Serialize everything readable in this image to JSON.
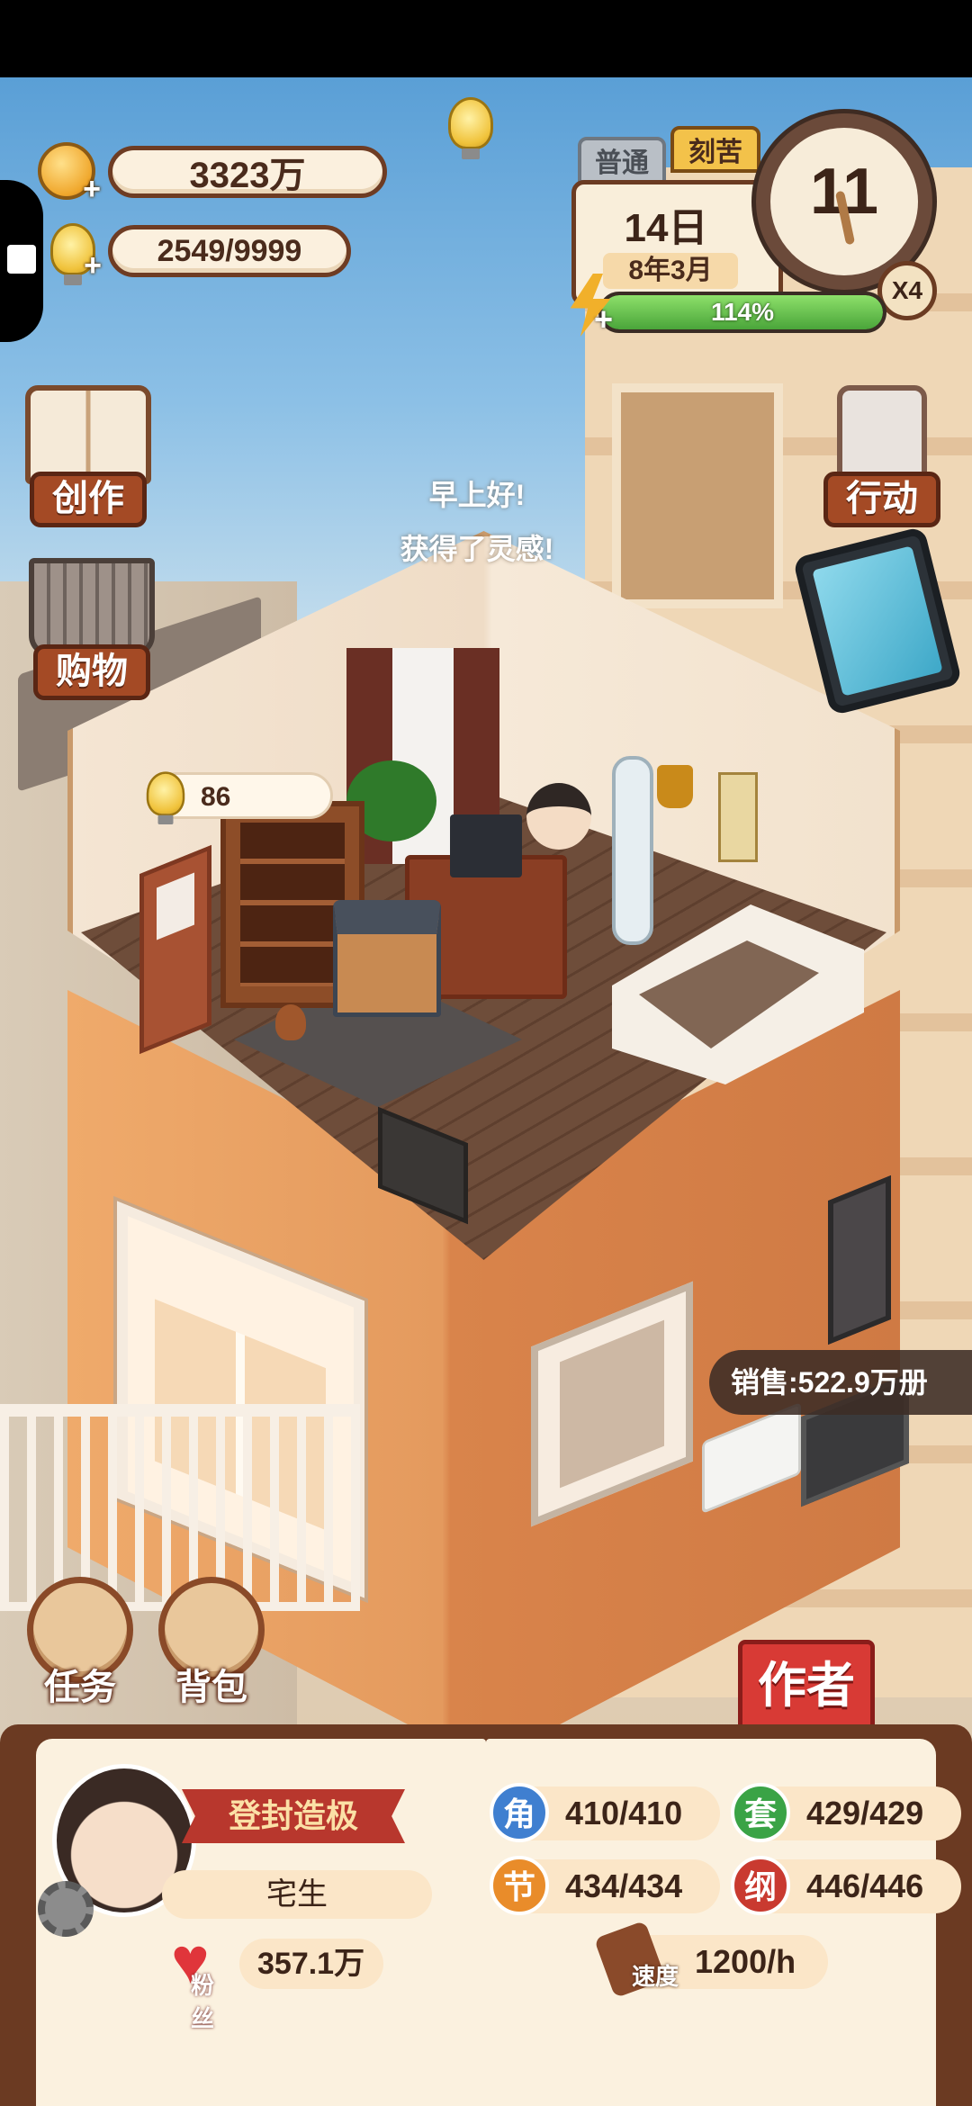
{
  "hud": {
    "coins": "3323万",
    "inspiration": "2549/9999",
    "energy_percent": "114%",
    "energy_fill": 1.0
  },
  "calendar": {
    "mode_normal": "普通",
    "mode_hard": "刻苦",
    "day": "14日",
    "year_month": "8年3月",
    "clock_hour": "11",
    "speed": "X4"
  },
  "menu": {
    "create": "创作",
    "shopping": "购物",
    "action": "行动",
    "tasks": "任务",
    "bag": "背包",
    "author": "作者"
  },
  "scene": {
    "greeting_line1": "早上好!",
    "greeting_line2": "获得了灵感!",
    "room_inspiration": "86",
    "sales": "销售:522.9万册"
  },
  "profile": {
    "rank": "登封造极",
    "pen_name": "宅生",
    "fans_label": "粉丝",
    "fans": "357.1万"
  },
  "stats": {
    "character_icon": "角",
    "character": "410/410",
    "routine_icon": "套",
    "routine": "429/429",
    "plot_icon": "节",
    "plot": "434/434",
    "outline_icon": "纲",
    "outline": "446/446",
    "speed_label": "速度",
    "speed": "1200/h"
  },
  "colors": {
    "stat_character": "#3f7fd0",
    "stat_routine": "#3aa346",
    "stat_plot": "#e98c2a",
    "stat_outline": "#c93a30"
  }
}
